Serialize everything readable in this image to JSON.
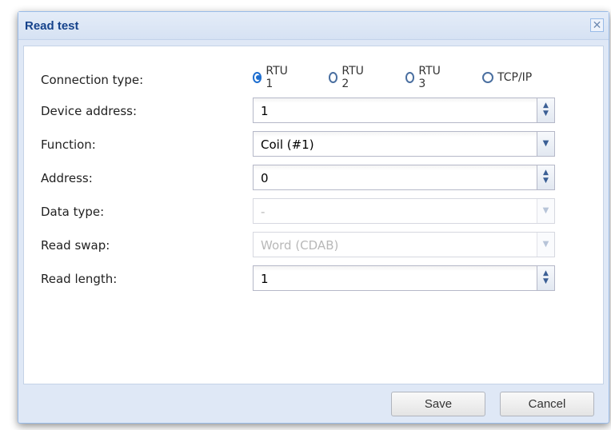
{
  "dialog": {
    "title": "Read test",
    "close_icon": "close-icon"
  },
  "form": {
    "connection_type": {
      "label": "Connection type:",
      "options": [
        "RTU 1",
        "RTU 2",
        "RTU 3",
        "TCP/IP"
      ],
      "selected": "RTU 1"
    },
    "device_address": {
      "label": "Device address:",
      "value": "1"
    },
    "function": {
      "label": "Function:",
      "value": "Coil (#1)"
    },
    "address": {
      "label": "Address:",
      "value": "0"
    },
    "data_type": {
      "label": "Data type:",
      "value": "-",
      "disabled": true
    },
    "read_swap": {
      "label": "Read swap:",
      "value": "Word (CDAB)",
      "disabled": true
    },
    "read_length": {
      "label": "Read length:",
      "value": "1"
    }
  },
  "buttons": {
    "save": "Save",
    "cancel": "Cancel"
  },
  "colors": {
    "title": "#15428b",
    "accent": "#1f6fd0",
    "frame": "#dfe8f6"
  }
}
